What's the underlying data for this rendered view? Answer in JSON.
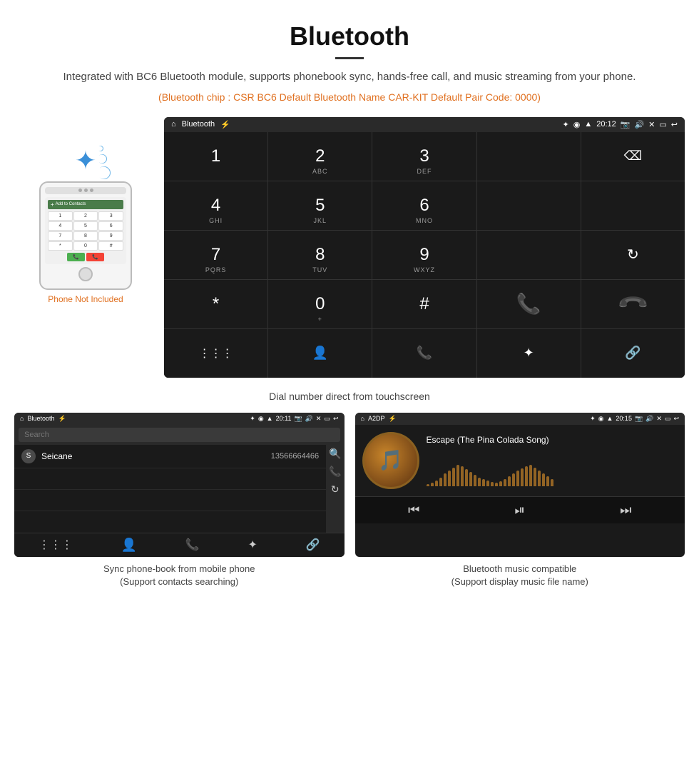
{
  "page": {
    "title": "Bluetooth",
    "divider": true,
    "subtitle": "Integrated with BC6 Bluetooth module, supports phonebook sync, hands-free call, and music streaming from your phone.",
    "orange_info": "(Bluetooth chip : CSR BC6    Default Bluetooth Name CAR-KIT    Default Pair Code: 0000)"
  },
  "phone_area": {
    "not_included_label": "Phone Not Included"
  },
  "car_screen": {
    "status": {
      "app_name": "Bluetooth",
      "time": "20:12"
    },
    "dialpad": {
      "keys": [
        {
          "label": "1",
          "sub": ""
        },
        {
          "label": "2",
          "sub": "ABC"
        },
        {
          "label": "3",
          "sub": "DEF"
        },
        {
          "label": "",
          "sub": ""
        },
        {
          "label": "⌫",
          "sub": ""
        },
        {
          "label": "4",
          "sub": "GHI"
        },
        {
          "label": "5",
          "sub": "JKL"
        },
        {
          "label": "6",
          "sub": "MNO"
        },
        {
          "label": "",
          "sub": ""
        },
        {
          "label": "",
          "sub": ""
        },
        {
          "label": "7",
          "sub": "PQRS"
        },
        {
          "label": "8",
          "sub": "TUV"
        },
        {
          "label": "9",
          "sub": "WXYZ"
        },
        {
          "label": "",
          "sub": ""
        },
        {
          "label": "↺",
          "sub": ""
        },
        {
          "label": "*",
          "sub": ""
        },
        {
          "label": "0",
          "sub": "+"
        },
        {
          "label": "#",
          "sub": ""
        },
        {
          "label": "📞",
          "sub": ""
        },
        {
          "label": "📞",
          "sub": ""
        }
      ]
    }
  },
  "main_caption": "Dial number direct from touchscreen",
  "phonebook_screen": {
    "status": {
      "app_name": "Bluetooth",
      "time": "20:11"
    },
    "search_placeholder": "Search",
    "contacts": [
      {
        "letter": "S",
        "name": "Seicane",
        "number": "13566664466"
      }
    ]
  },
  "music_screen": {
    "status": {
      "app_name": "A2DP",
      "time": "20:15"
    },
    "song_title": "Escape (The Pina Colada Song)",
    "artist": "",
    "viz_bars": [
      3,
      5,
      8,
      12,
      18,
      22,
      26,
      30,
      28,
      24,
      20,
      16,
      12,
      10,
      8,
      6,
      5,
      7,
      10,
      14,
      18,
      22,
      25,
      28,
      30,
      26,
      22,
      18,
      14,
      10
    ]
  },
  "phonebook_caption": {
    "line1": "Sync phone-book from mobile phone",
    "line2": "(Support contacts searching)"
  },
  "music_caption": {
    "line1": "Bluetooth music compatible",
    "line2": "(Support display music file name)"
  }
}
